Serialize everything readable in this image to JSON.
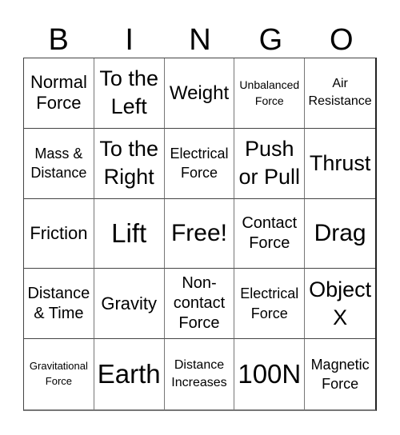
{
  "title": {
    "letters": [
      "B",
      "I",
      "N",
      "G",
      "O"
    ]
  },
  "grid": {
    "rows": [
      [
        "Normal\nForce",
        "To the\nLeft",
        "Weight",
        "Unbalanced\nForce",
        "Air\nResistance"
      ],
      [
        "Mass &\nDistance",
        "To the\nRight",
        "Electrical\nForce",
        "Push\nor Pull",
        "Thrust"
      ],
      [
        "Friction",
        "Lift",
        "Free!",
        "Contact\nForce",
        "Drag"
      ],
      [
        "Distance\n& Time",
        "Gravity",
        "Non-\ncontact\nForce",
        "Electrical\nForce",
        "Object\nX"
      ],
      [
        "Gravitational\nForce",
        "Earth",
        "Distance\nIncreases",
        "100N",
        "Magnetic\nForce"
      ]
    ]
  }
}
